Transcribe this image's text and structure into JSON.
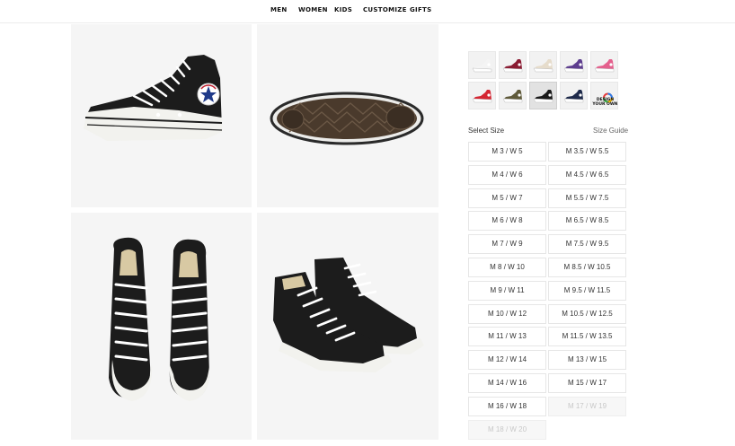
{
  "nav": {
    "items": [
      "MEN",
      "WOMEN",
      "KIDS",
      "CUSTOMIZE",
      "GIFTS"
    ]
  },
  "swatches": [
    {
      "name": "white",
      "color": "#f4f4f4",
      "sole": "#ffffff"
    },
    {
      "name": "maroon",
      "color": "#8a1b32",
      "sole": "#ffffff"
    },
    {
      "name": "natural-ivory",
      "color": "#e6dccb",
      "sole": "#ffffff"
    },
    {
      "name": "purple",
      "color": "#5d3d8e",
      "sole": "#ffffff"
    },
    {
      "name": "pink",
      "color": "#e4608d",
      "sole": "#ffffff"
    },
    {
      "name": "red",
      "color": "#d42632",
      "sole": "#ffffff"
    },
    {
      "name": "olive",
      "color": "#5f5a3a",
      "sole": "#ffffff"
    },
    {
      "name": "black",
      "color": "#1a1a1a",
      "sole": "#ffffff",
      "active": true
    },
    {
      "name": "navy",
      "color": "#1e2a4a",
      "sole": "#ffffff"
    },
    {
      "name": "design-your-own",
      "label": "DESIGN YOUR OWN"
    }
  ],
  "sizes": {
    "select_label": "Select Size",
    "guide_label": "Size Guide",
    "options": [
      {
        "label": "M 3 / W 5",
        "available": true
      },
      {
        "label": "M 3.5 / W 5.5",
        "available": true
      },
      {
        "label": "M 4 / W 6",
        "available": true
      },
      {
        "label": "M 4.5 / W 6.5",
        "available": true
      },
      {
        "label": "M 5 / W 7",
        "available": true
      },
      {
        "label": "M 5.5 / W 7.5",
        "available": true
      },
      {
        "label": "M 6 / W 8",
        "available": true
      },
      {
        "label": "M 6.5 / W 8.5",
        "available": true
      },
      {
        "label": "M 7 / W 9",
        "available": true
      },
      {
        "label": "M 7.5 / W 9.5",
        "available": true
      },
      {
        "label": "M 8 / W 10",
        "available": true
      },
      {
        "label": "M 8.5 / W 10.5",
        "available": true
      },
      {
        "label": "M 9 / W 11",
        "available": true
      },
      {
        "label": "M 9.5 / W 11.5",
        "available": true
      },
      {
        "label": "M 10 / W 12",
        "available": true
      },
      {
        "label": "M 10.5 / W 12.5",
        "available": true
      },
      {
        "label": "M 11 / W 13",
        "available": true
      },
      {
        "label": "M 11.5 / W 13.5",
        "available": true
      },
      {
        "label": "M 12 / W 14",
        "available": true
      },
      {
        "label": "M 13 / W 15",
        "available": true
      },
      {
        "label": "M 14 / W 16",
        "available": true
      },
      {
        "label": "M 15 / W 17",
        "available": true
      },
      {
        "label": "M 16 / W 18",
        "available": true
      },
      {
        "label": "M 17 / W 19",
        "available": false
      },
      {
        "label": "M 18 / W 20",
        "available": false
      }
    ]
  },
  "colors": {
    "canvas": "#ffffff",
    "tile": "#f5f5f5",
    "shoe_black": "#1c1c1c",
    "rubber_white": "#f2f2ee",
    "sole_brown": "#4a3a2c",
    "laces": "#ffffff"
  }
}
